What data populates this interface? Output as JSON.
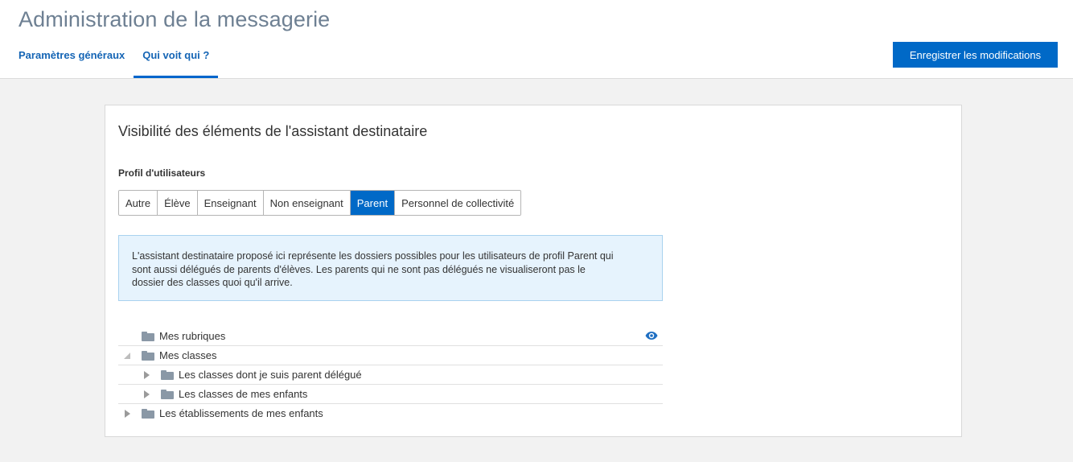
{
  "header": {
    "title": "Administration de la messagerie",
    "tabs": [
      {
        "label": "Paramètres généraux",
        "active": false
      },
      {
        "label": "Qui voit qui ?",
        "active": true
      }
    ],
    "save_label": "Enregistrer les modifications"
  },
  "card": {
    "title": "Visibilité des éléments de l'assistant destinataire",
    "profile_label": "Profil d'utilisateurs",
    "profiles": [
      "Autre",
      "Élève",
      "Enseignant",
      "Non enseignant",
      "Parent",
      "Personnel de collectivité"
    ],
    "selected_profile": "Parent",
    "info_text": "L'assistant destinataire proposé ici représente les dossiers possibles pour les utilisateurs de profil Parent qui sont aussi délégués de parents d'élèves. Les parents qui ne sont pas délégués ne visualiseront pas le dossier des classes quoi qu'il arrive.",
    "tree": [
      {
        "label": "Mes rubriques",
        "level": 0,
        "expander": "none",
        "visible_icon": true
      },
      {
        "label": "Mes classes",
        "level": 0,
        "expander": "expanded",
        "visible_icon": false
      },
      {
        "label": "Les classes dont je suis parent délégué",
        "level": 1,
        "expander": "collapsed",
        "visible_icon": false
      },
      {
        "label": "Les classes de mes enfants",
        "level": 1,
        "expander": "collapsed",
        "visible_icon": false
      },
      {
        "label": "Les établissements de mes enfants",
        "level": 0,
        "expander": "collapsed",
        "visible_icon": false
      }
    ]
  },
  "colors": {
    "accent": "#0069c7",
    "title": "#6e8093",
    "folder": "#8a98a6",
    "info_bg": "#e6f3fd"
  },
  "icons": {
    "folder": "folder-icon",
    "visibility": "eye-icon",
    "expand": "caret-right-icon",
    "collapse": "caret-down-icon"
  }
}
